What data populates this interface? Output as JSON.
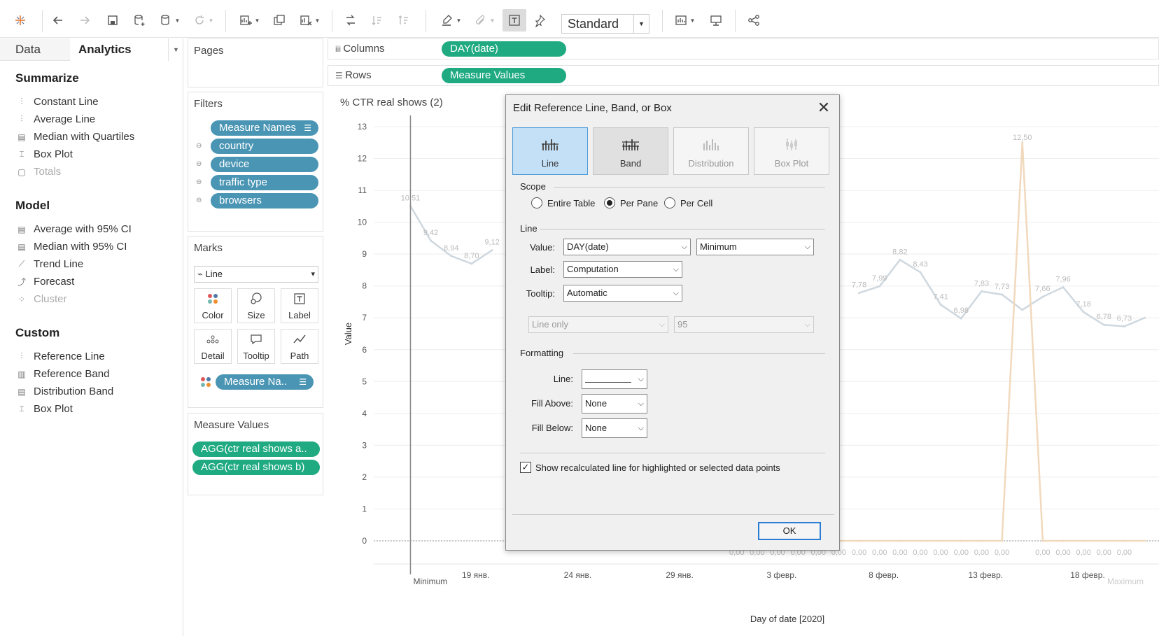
{
  "toolbar": {
    "fit_value": "Standard"
  },
  "left": {
    "tabs": [
      "Data",
      "Analytics"
    ],
    "sections": [
      {
        "title": "Summarize",
        "items": [
          {
            "label": "Constant Line",
            "icon": "constant-line-icon",
            "disabled": false
          },
          {
            "label": "Average Line",
            "icon": "average-line-icon",
            "disabled": false
          },
          {
            "label": "Median with Quartiles",
            "icon": "median-quartiles-icon",
            "disabled": false
          },
          {
            "label": "Box Plot",
            "icon": "box-plot-icon",
            "disabled": false
          },
          {
            "label": "Totals",
            "icon": "totals-icon",
            "disabled": true
          }
        ]
      },
      {
        "title": "Model",
        "items": [
          {
            "label": "Average with 95% CI",
            "icon": "average-ci-icon",
            "disabled": false
          },
          {
            "label": "Median with 95% CI",
            "icon": "median-ci-icon",
            "disabled": false
          },
          {
            "label": "Trend Line",
            "icon": "trend-line-icon",
            "disabled": false
          },
          {
            "label": "Forecast",
            "icon": "forecast-icon",
            "disabled": false
          },
          {
            "label": "Cluster",
            "icon": "cluster-icon",
            "disabled": true
          }
        ]
      },
      {
        "title": "Custom",
        "items": [
          {
            "label": "Reference Line",
            "icon": "reference-line-icon",
            "disabled": false
          },
          {
            "label": "Reference Band",
            "icon": "reference-band-icon",
            "disabled": false
          },
          {
            "label": "Distribution Band",
            "icon": "distribution-band-icon",
            "disabled": false
          },
          {
            "label": "Box Plot",
            "icon": "box-plot-icon",
            "disabled": false
          }
        ]
      }
    ]
  },
  "cards": {
    "pages": "Pages",
    "filters": "Filters",
    "filter_pills": [
      "Measure Names",
      "country",
      "device",
      "traffic type",
      "browsers"
    ],
    "marks": "Marks",
    "mark_type": "Line",
    "mark_buttons": [
      "Color",
      "Size",
      "Label",
      "Detail",
      "Tooltip",
      "Path"
    ],
    "mark_pill": "Measure Na..",
    "measure_values": "Measure Values",
    "measure_pills": [
      "AGG(ctr real shows a..",
      "AGG(ctr real shows b)"
    ]
  },
  "shelves": {
    "columns_label": "Columns",
    "columns_pill": "DAY(date)",
    "rows_label": "Rows",
    "rows_pill": "Measure Values"
  },
  "chart_data": {
    "type": "line",
    "title": "% CTR real shows (2)",
    "xlabel": "Day of date [2020]",
    "ylabel": "Value",
    "ylim": [
      0,
      13
    ],
    "y_ticks": [
      0,
      1,
      2,
      3,
      4,
      5,
      6,
      7,
      8,
      9,
      10,
      11,
      12,
      13
    ],
    "x_ticks": [
      "19 янв.",
      "24 янв.",
      "29 янв.",
      "3 февр.",
      "8 февр.",
      "13 февр.",
      "18 февр."
    ],
    "x_tick_days": [
      5,
      10,
      15,
      20,
      25,
      30,
      35
    ],
    "reference_lines": [
      {
        "label": "Minimum",
        "day": 1.8
      },
      {
        "label": "Maximum",
        "day": 37.7
      }
    ],
    "series": [
      {
        "color": "#cfd8df",
        "x": [
          1.8,
          2.8,
          3.8,
          4.8,
          5.8,
          23.8,
          24.8,
          25.8,
          26.8,
          27.8,
          28.8,
          29.8,
          30.8,
          31.8,
          32.8,
          33.8,
          34.8,
          35.8,
          36.8,
          37.8
        ],
        "values": [
          10.51,
          9.42,
          8.94,
          8.7,
          9.12,
          7.78,
          7.99,
          8.82,
          8.43,
          7.41,
          6.98,
          7.83,
          7.73,
          7.25,
          7.66,
          7.96,
          7.18,
          6.78,
          6.73,
          7.0
        ],
        "labels": [
          "10,51",
          "9,42",
          "8,94",
          "8,70",
          "9,12",
          "7,78",
          "7,99",
          "8,82",
          "8,43",
          "7,41",
          "6,98",
          "7,83",
          "7,73",
          "",
          "7,66",
          "7,96",
          "7,18",
          "6,78",
          "6,73",
          ""
        ]
      },
      {
        "color": "#f1d9bd",
        "x": [
          17.8,
          18.8,
          19.8,
          20.8,
          21.8,
          22.8,
          23.8,
          24.8,
          25.8,
          26.8,
          27.8,
          28.8,
          29.8,
          30.8,
          31.8,
          32.8,
          33.8,
          34.8,
          35.8,
          36.8,
          37.8
        ],
        "values": [
          0,
          0,
          0,
          0,
          0,
          0,
          0,
          0,
          0,
          0,
          0,
          0,
          0,
          0,
          12.5,
          0,
          0,
          0,
          0,
          0,
          0
        ],
        "labels": [
          "0,00",
          "0,00",
          "0,00",
          "0,00",
          "0,00",
          "0,00",
          "0,00",
          "0,00",
          "0,00",
          "0,00",
          "0,00",
          "0,00",
          "0,00",
          "0,00",
          "12,50",
          "0,00",
          "0,00",
          "0,00",
          "0,00",
          "0,00",
          ""
        ]
      }
    ]
  },
  "dialog": {
    "title": "Edit Reference Line, Band, or Box",
    "types": [
      "Line",
      "Band",
      "Distribution",
      "Box Plot"
    ],
    "scope_label": "Scope",
    "scope_options": [
      "Entire Table",
      "Per Pane",
      "Per Cell"
    ],
    "line_group": "Line",
    "value_label": "Value:",
    "value_field": "DAY(date)",
    "value_agg": "Minimum",
    "label_label": "Label:",
    "label_value": "Computation",
    "tooltip_label": "Tooltip:",
    "tooltip_value": "Automatic",
    "ci_type": "Line only",
    "ci_level": "95",
    "formatting_group": "Formatting",
    "line_fmt_label": "Line:",
    "fill_above_label": "Fill Above:",
    "fill_above_value": "None",
    "fill_below_label": "Fill Below:",
    "fill_below_value": "None",
    "recalc_label": "Show recalculated line for highlighted or selected data points",
    "ok_label": "OK"
  }
}
